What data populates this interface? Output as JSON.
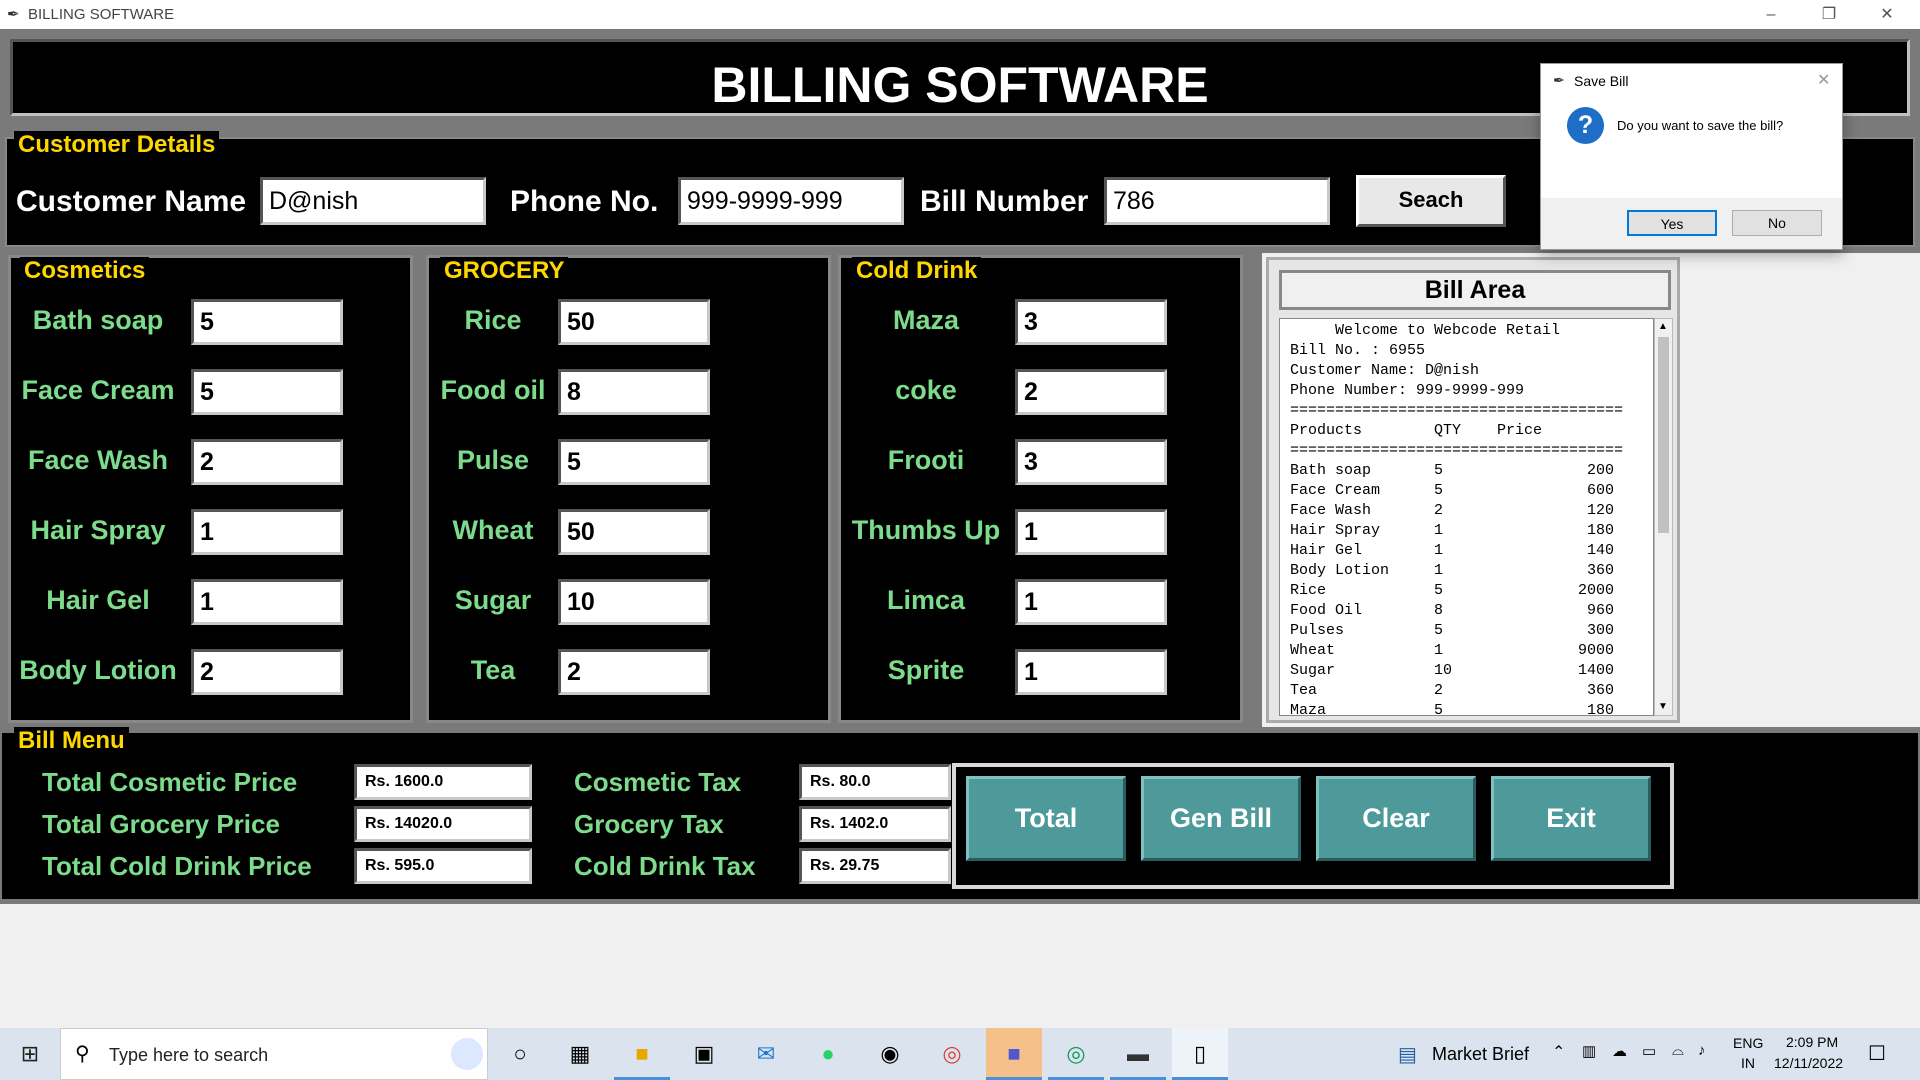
{
  "window": {
    "title": "BILLING SOFTWARE"
  },
  "header": {
    "title": "BILLING SOFTWARE"
  },
  "customer": {
    "frame_label": "Customer Details",
    "name_label": "Customer Name",
    "name_value": "D@nish",
    "phone_label": "Phone No.",
    "phone_value": "999-9999-999",
    "bill_label": "Bill Number",
    "bill_value": "786",
    "search_label": "Seach"
  },
  "cosmetics": {
    "label": "Cosmetics",
    "items": [
      {
        "name": "Bath soap",
        "qty": "5"
      },
      {
        "name": "Face Cream",
        "qty": "5"
      },
      {
        "name": "Face Wash",
        "qty": "2"
      },
      {
        "name": "Hair Spray",
        "qty": "1"
      },
      {
        "name": "Hair Gel",
        "qty": "1"
      },
      {
        "name": "Body Lotion",
        "qty": "2"
      }
    ]
  },
  "grocery": {
    "label": "GROCERY",
    "items": [
      {
        "name": "Rice",
        "qty": "50"
      },
      {
        "name": "Food oil",
        "qty": "8"
      },
      {
        "name": "Pulse",
        "qty": "5"
      },
      {
        "name": "Wheat",
        "qty": "50"
      },
      {
        "name": "Sugar",
        "qty": "10"
      },
      {
        "name": "Tea",
        "qty": "2"
      }
    ]
  },
  "colddrink": {
    "label": "Cold Drink",
    "items": [
      {
        "name": "Maza",
        "qty": "3"
      },
      {
        "name": "coke",
        "qty": "2"
      },
      {
        "name": "Frooti",
        "qty": "3"
      },
      {
        "name": "Thumbs Up",
        "qty": "1"
      },
      {
        "name": "Limca",
        "qty": "1"
      },
      {
        "name": "Sprite",
        "qty": "1"
      }
    ]
  },
  "bill_area": {
    "title": "Bill Area",
    "lines": [
      "     Welcome to Webcode Retail",
      "Bill No. : 6955",
      "Customer Name: D@nish",
      "Phone Number: 999-9999-999",
      "=====================================",
      "Products        QTY    Price",
      "=====================================",
      "Bath soap       5                200",
      "Face Cream      5                600",
      "Face Wash       2                120",
      "Hair Spray      1                180",
      "Hair Gel        1                140",
      "Body Lotion     1                360",
      "Rice            5               2000",
      "Food Oil        8                960",
      "Pulses          5                300",
      "Wheat           1               9000",
      "Sugar           10              1400",
      "Tea             2                360",
      "Maza            5                180"
    ]
  },
  "bill_menu": {
    "label": "Bill Menu",
    "total_cosmetic_label": "Total Cosmetic Price",
    "total_cosmetic_value": "Rs. 1600.0",
    "total_grocery_label": "Total Grocery Price",
    "total_grocery_value": "Rs. 14020.0",
    "total_colddrink_label": "Total Cold Drink Price",
    "total_colddrink_value": "Rs. 595.0",
    "cosmetic_tax_label": "Cosmetic Tax",
    "cosmetic_tax_value": "Rs. 80.0",
    "grocery_tax_label": "Grocery Tax",
    "grocery_tax_value": "Rs. 1402.0",
    "colddrink_tax_label": "Cold Drink Tax",
    "colddrink_tax_value": "Rs. 29.75",
    "buttons": {
      "total": "Total",
      "gen_bill": "Gen Bill",
      "clear": "Clear",
      "exit": "Exit"
    }
  },
  "dialog": {
    "title": "Save Bill",
    "message": "Do you want to save the bill?",
    "yes": "Yes",
    "no": "No"
  },
  "taskbar": {
    "search_placeholder": "Type here to search",
    "news": "Market Brief",
    "lang1": "ENG",
    "lang2": "IN",
    "time": "2:09 PM",
    "date": "12/11/2022"
  },
  "colors": {
    "accent_label": "#ffd700",
    "item_label": "#7ddb8c",
    "button_teal": "#4e9a9a"
  }
}
